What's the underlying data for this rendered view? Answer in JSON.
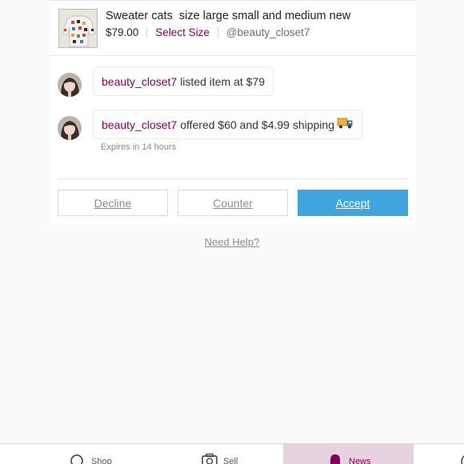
{
  "listing": {
    "title": "Sweater cats  size large small and medium new",
    "price": "$79.00",
    "size_link": "Select Size",
    "seller": "@beauty_closet7"
  },
  "activity": [
    {
      "user": "beauty_closet7",
      "text": "listed item at $79"
    },
    {
      "user": "beauty_closet7",
      "text": "offered $60 and $4.99 shipping",
      "emoji": "shipping-truck-icon",
      "expires": "Expires in 14 hours"
    }
  ],
  "actions": {
    "decline": "Decline",
    "counter": "Counter",
    "accept": "Accept"
  },
  "help_link": "Need Help?",
  "tabs": [
    {
      "label": "Shop",
      "icon": "search-icon",
      "active": false
    },
    {
      "label": "Sell",
      "icon": "camera-icon",
      "active": false
    },
    {
      "label": "News",
      "icon": "bell-icon",
      "active": true
    }
  ],
  "colors": {
    "brand": "#7f0353",
    "accept": "#3ea5de",
    "active_tab_bg": "#e7d3e0"
  }
}
